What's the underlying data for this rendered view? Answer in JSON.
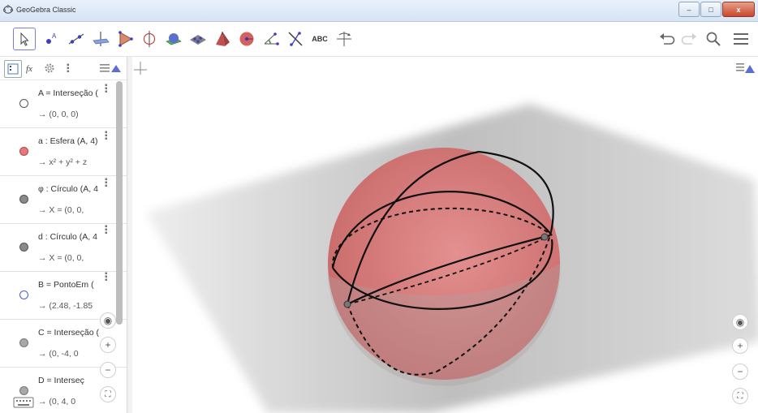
{
  "window": {
    "title": "GeoGebra Classic",
    "minimize": "–",
    "maximize": "□",
    "close": "x"
  },
  "toolbar": {
    "tools": [
      {
        "name": "move-tool-icon"
      },
      {
        "name": "point-tool-icon"
      },
      {
        "name": "line-tool-icon"
      },
      {
        "name": "perpendicular-tool-icon"
      },
      {
        "name": "polygon-tool-icon"
      },
      {
        "name": "circle-axis-tool-icon"
      },
      {
        "name": "intersect-surfaces-tool-icon"
      },
      {
        "name": "plane-tool-icon"
      },
      {
        "name": "pyramid-tool-icon"
      },
      {
        "name": "sphere-tool-icon"
      },
      {
        "name": "angle-tool-icon"
      },
      {
        "name": "reflect-tool-icon"
      },
      {
        "name": "text-tool-icon",
        "label": "ABC"
      },
      {
        "name": "rotate-view-tool-icon"
      }
    ],
    "right": [
      "undo-icon",
      "redo-icon",
      "search-icon",
      "menu-icon"
    ]
  },
  "algebra": {
    "rows": [
      {
        "def": "A = Interseção (",
        "val": "→  (0, 0, 0)",
        "color": "#ffffff",
        "border": "#555555"
      },
      {
        "def": "a : Esfera (A, 4)",
        "val": "→  x² + y² + z",
        "color": "#e87878",
        "border": "#b04848"
      },
      {
        "def": "φ : Círculo (A, 4",
        "val": "→  X = (0, 0,",
        "color": "#8a8a8a",
        "border": "#555555"
      },
      {
        "def": "d : Círculo (A, 4",
        "val": "→  X = (0, 0,",
        "color": "#8a8a8a",
        "border": "#555555"
      },
      {
        "def": "B = PontoEm (",
        "val": "→  (2.48, -1.85",
        "color": "#ffffff",
        "border": "#4a5bd0"
      },
      {
        "def": "C = Interseção (",
        "val": "→  (0, -4, 0",
        "color": "#a8a8a8",
        "border": "#777777"
      },
      {
        "def": "D = Interseç",
        "val": "→  (0, 4, 0",
        "color": "#a8a8a8",
        "border": "#777777"
      }
    ]
  },
  "nav": {
    "home": "◉",
    "zoom_in": "+",
    "zoom_out": "−",
    "fullscreen": "⛶"
  },
  "colors": {
    "sphere": "#e07070",
    "plane": "#9a9a9a",
    "accent": "#6557d2"
  }
}
